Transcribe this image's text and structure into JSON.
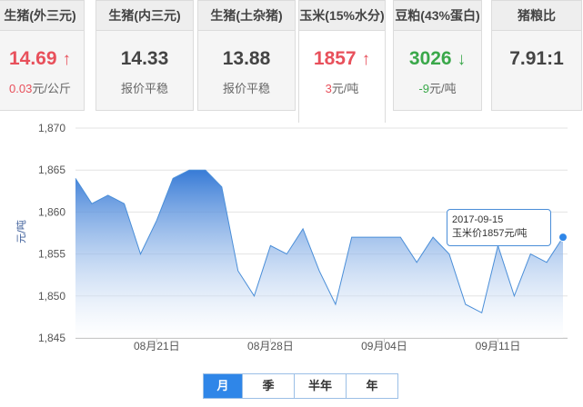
{
  "tabs": [
    {
      "title": "生猪(外三元)",
      "value": "14.69",
      "trend": "up",
      "sub_num": "0.03",
      "sub_unit": "元/公斤",
      "sub_text": ""
    },
    {
      "title": "生猪(内三元)",
      "value": "14.33",
      "trend": "none",
      "sub_num": "",
      "sub_unit": "",
      "sub_text": "报价平稳"
    },
    {
      "title": "生猪(土杂猪)",
      "value": "13.88",
      "trend": "none",
      "sub_num": "",
      "sub_unit": "",
      "sub_text": "报价平稳"
    },
    {
      "title": "玉米(15%水分)",
      "value": "1857",
      "trend": "up",
      "sub_num": "3",
      "sub_unit": "元/吨",
      "sub_text": ""
    },
    {
      "title": "豆粕(43%蛋白)",
      "value": "3026",
      "trend": "down",
      "sub_num": "-9",
      "sub_unit": "元/吨",
      "sub_text": ""
    },
    {
      "title": "猪粮比",
      "value": "7.91:1",
      "trend": "none",
      "sub_num": "",
      "sub_unit": "",
      "sub_text": ""
    }
  ],
  "active_tab": 3,
  "colors": {
    "up": "#e8505b",
    "down": "#3aa84a",
    "line": "#4a8ed8",
    "accent": "#2f86e8"
  },
  "chart_data": {
    "type": "area",
    "ylabel": "元/吨",
    "ylim": [
      1845,
      1870
    ],
    "yticks": [
      1845,
      1850,
      1855,
      1860,
      1865,
      1870
    ],
    "ytick_labels": [
      "1,845",
      "1,850",
      "1,855",
      "1,860",
      "1,865",
      "1,870"
    ],
    "xlim": [
      "2017-08-16",
      "2017-09-15"
    ],
    "xticks": [
      "2017-08-21",
      "2017-08-28",
      "2017-09-04",
      "2017-09-11"
    ],
    "xtick_labels": [
      "08月21日",
      "08月28日",
      "09月04日",
      "09月11日"
    ],
    "grid": true,
    "series": [
      {
        "name": "玉米价",
        "points": [
          [
            "2017-08-16",
            1864
          ],
          [
            "2017-08-17",
            1861
          ],
          [
            "2017-08-18",
            1862
          ],
          [
            "2017-08-19",
            1861
          ],
          [
            "2017-08-20",
            1855
          ],
          [
            "2017-08-21",
            1859
          ],
          [
            "2017-08-22",
            1864
          ],
          [
            "2017-08-23",
            1865
          ],
          [
            "2017-08-24",
            1865
          ],
          [
            "2017-08-25",
            1863
          ],
          [
            "2017-08-26",
            1853
          ],
          [
            "2017-08-27",
            1850
          ],
          [
            "2017-08-28",
            1856
          ],
          [
            "2017-08-29",
            1855
          ],
          [
            "2017-08-30",
            1858
          ],
          [
            "2017-08-31",
            1853
          ],
          [
            "2017-09-01",
            1849
          ],
          [
            "2017-09-02",
            1857
          ],
          [
            "2017-09-03",
            1857
          ],
          [
            "2017-09-04",
            1857
          ],
          [
            "2017-09-05",
            1857
          ],
          [
            "2017-09-06",
            1854
          ],
          [
            "2017-09-07",
            1857
          ],
          [
            "2017-09-08",
            1855
          ],
          [
            "2017-09-09",
            1849
          ],
          [
            "2017-09-10",
            1848
          ],
          [
            "2017-09-11",
            1856
          ],
          [
            "2017-09-12",
            1850
          ],
          [
            "2017-09-13",
            1855
          ],
          [
            "2017-09-14",
            1854
          ],
          [
            "2017-09-15",
            1857
          ]
        ]
      }
    ],
    "tooltip": {
      "date": "2017-09-15",
      "text": "玉米价1857元/吨"
    }
  },
  "periods": [
    "月",
    "季",
    "半年",
    "年"
  ],
  "active_period": 0
}
